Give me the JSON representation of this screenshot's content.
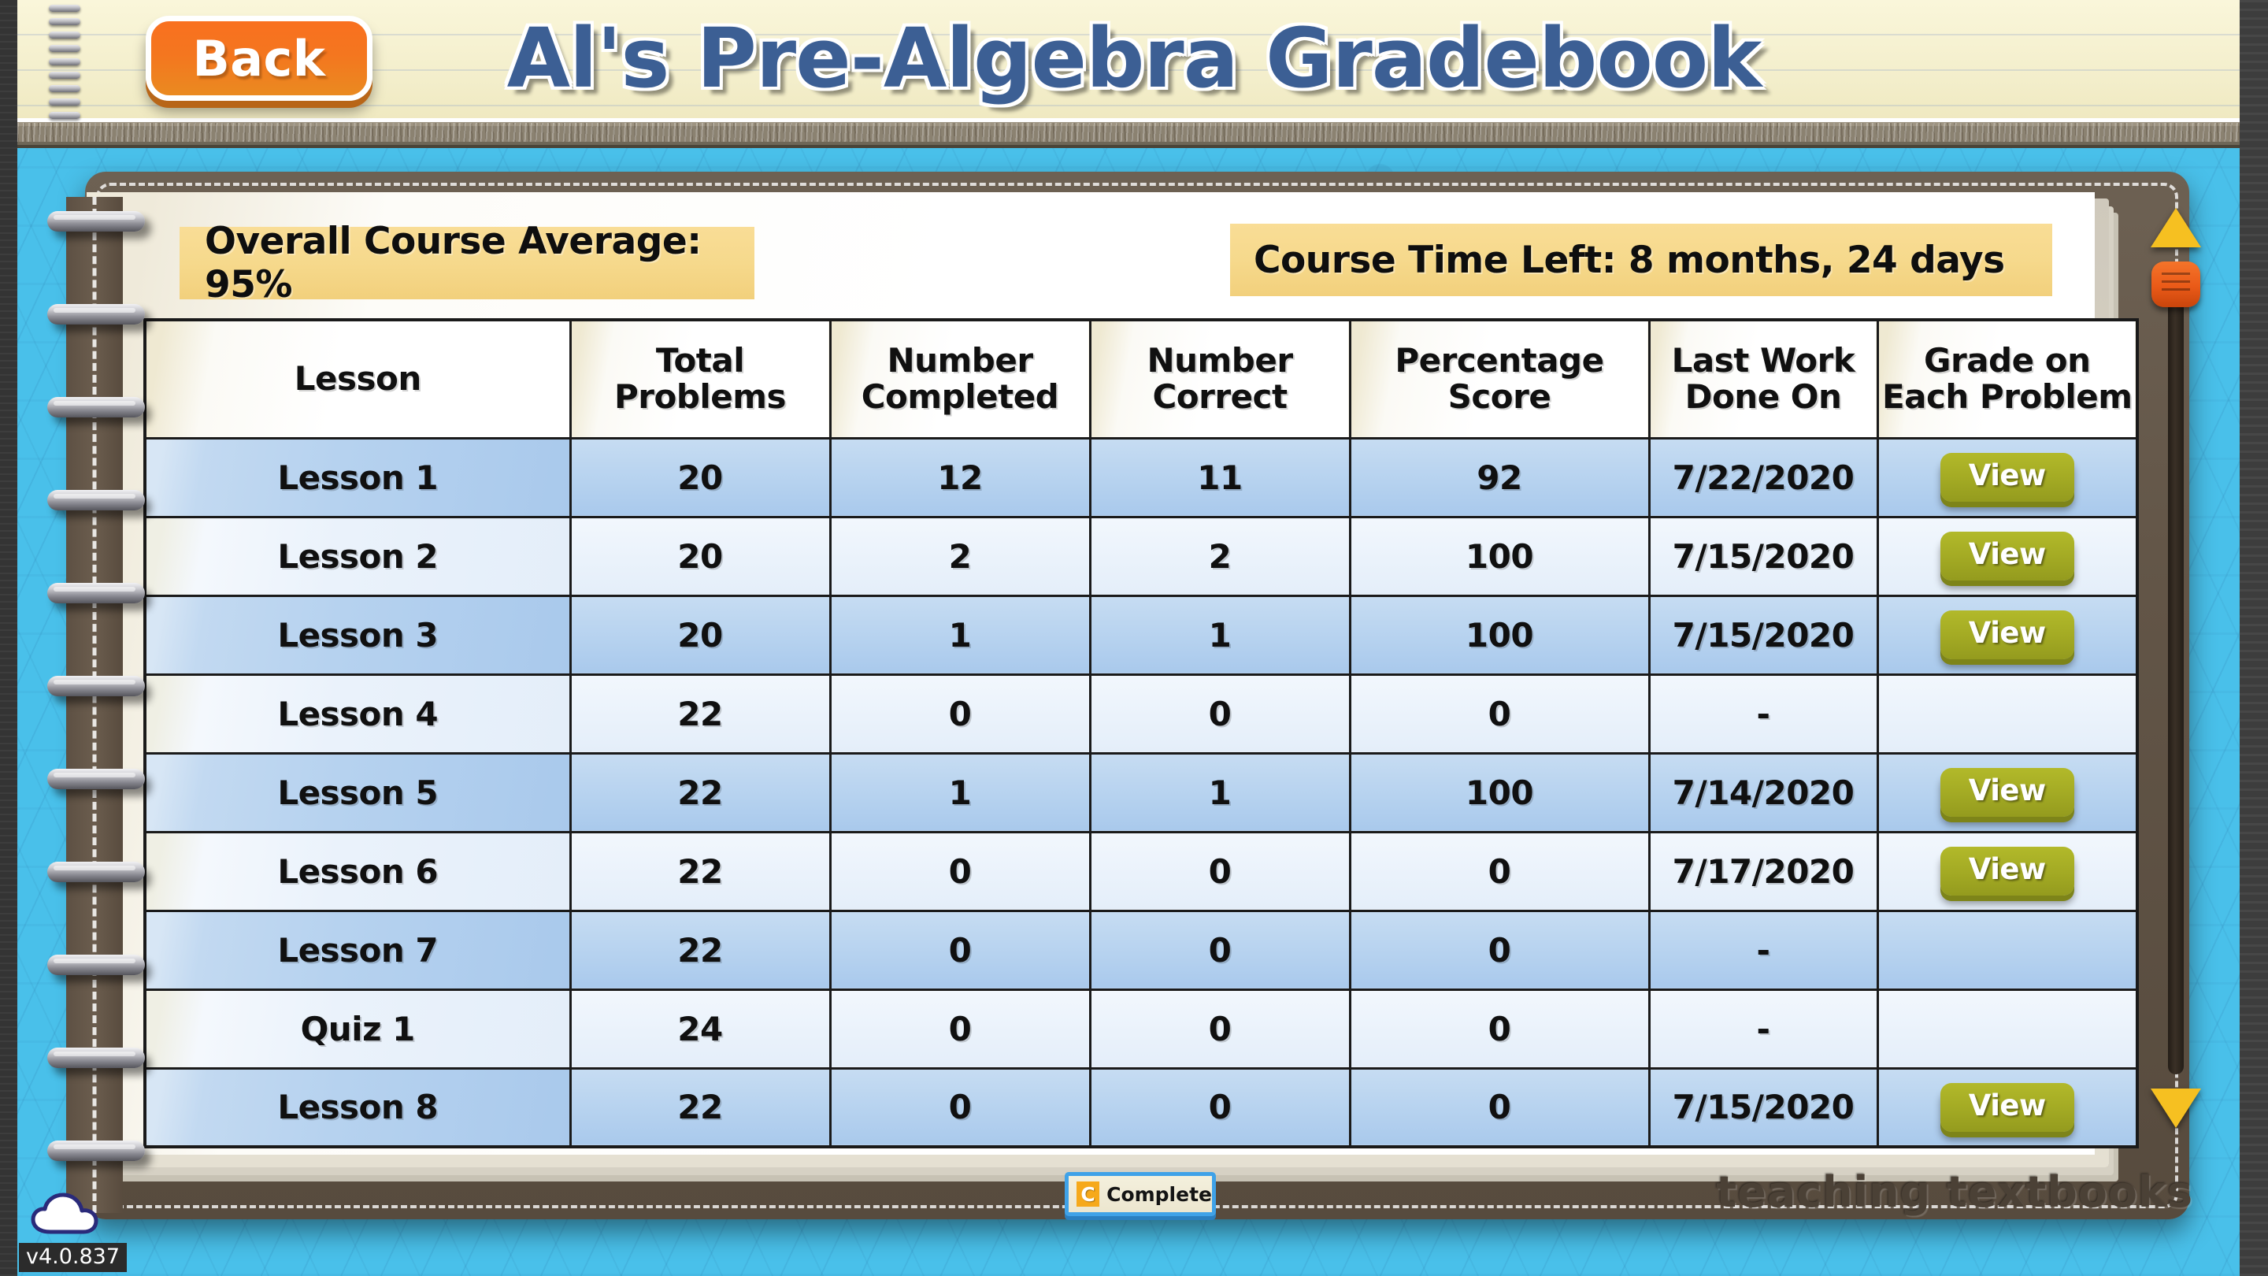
{
  "header": {
    "back_label": "Back",
    "title": "Al's Pre-Algebra Gradebook"
  },
  "banners": {
    "average_label": "Overall Course Average: 95%",
    "time_left_label": "Course Time Left:  8 months, 24 days"
  },
  "table": {
    "headers": [
      "Lesson",
      "Total Problems",
      "Number Completed",
      "Number Correct",
      "Percentage Score",
      "Last Work Done On",
      "Grade on Each Problem"
    ],
    "view_label": "View",
    "rows": [
      {
        "lesson": "Lesson 1",
        "total": "20",
        "completed": "12",
        "correct": "11",
        "percentage": "92",
        "last_work": "7/22/2020",
        "has_view": true
      },
      {
        "lesson": "Lesson 2",
        "total": "20",
        "completed": "2",
        "correct": "2",
        "percentage": "100",
        "last_work": "7/15/2020",
        "has_view": true
      },
      {
        "lesson": "Lesson 3",
        "total": "20",
        "completed": "1",
        "correct": "1",
        "percentage": "100",
        "last_work": "7/15/2020",
        "has_view": true
      },
      {
        "lesson": "Lesson 4",
        "total": "22",
        "completed": "0",
        "correct": "0",
        "percentage": "0",
        "last_work": "-",
        "has_view": false
      },
      {
        "lesson": "Lesson 5",
        "total": "22",
        "completed": "1",
        "correct": "1",
        "percentage": "100",
        "last_work": "7/14/2020",
        "has_view": true
      },
      {
        "lesson": "Lesson 6",
        "total": "22",
        "completed": "0",
        "correct": "0",
        "percentage": "0",
        "last_work": "7/17/2020",
        "has_view": true
      },
      {
        "lesson": "Lesson 7",
        "total": "22",
        "completed": "0",
        "correct": "0",
        "percentage": "0",
        "last_work": "-",
        "has_view": false
      },
      {
        "lesson": "Quiz 1",
        "total": "24",
        "completed": "0",
        "correct": "0",
        "percentage": "0",
        "last_work": "-",
        "has_view": false
      },
      {
        "lesson": "Lesson 8",
        "total": "22",
        "completed": "0",
        "correct": "0",
        "percentage": "0",
        "last_work": "7/15/2020",
        "has_view": true
      }
    ]
  },
  "footer": {
    "complete_icon_letter": "C",
    "complete_label": "Complete",
    "brand": "teaching textbooks",
    "version": "v4.0.837"
  },
  "colors": {
    "accent_orange": "#f4761f",
    "title_blue": "#3c5f94",
    "banner_gold": "#f6d98c",
    "row_blue": "#b6d2ef",
    "view_olive": "#a4ab24",
    "wallpaper_cyan": "#49c0ea",
    "binder_brown": "#625547"
  }
}
